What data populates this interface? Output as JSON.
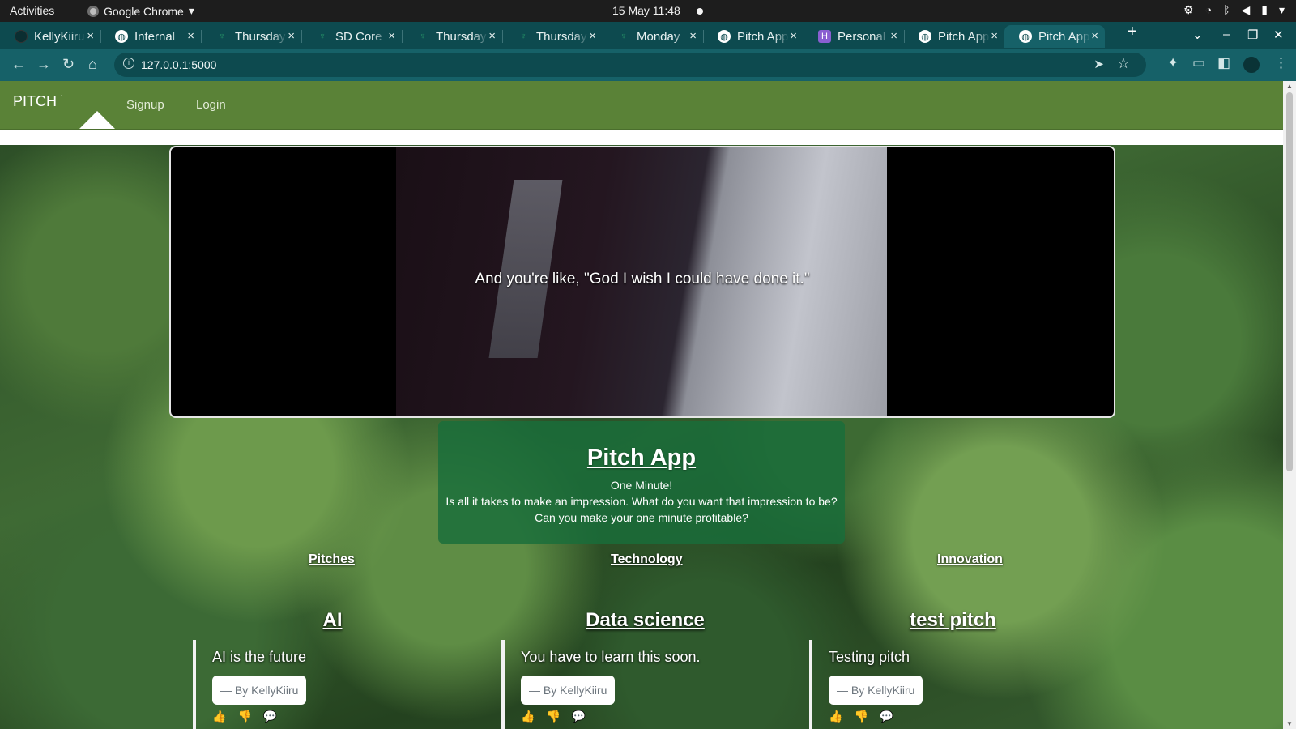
{
  "system_bar": {
    "activities": "Activities",
    "app_name": "Google Chrome",
    "app_menu_arrow": "▾",
    "datetime": "15 May  11:48"
  },
  "browser": {
    "tabs": [
      {
        "label": "KellyKiiru",
        "icon": "github-icon"
      },
      {
        "label": "Internal",
        "icon": "globe-icon"
      },
      {
        "label": "Thursday",
        "icon": "moringa-icon"
      },
      {
        "label": "SD Core",
        "icon": "moringa-icon"
      },
      {
        "label": "Thursday",
        "icon": "moringa-icon"
      },
      {
        "label": "Thursday",
        "icon": "moringa-icon"
      },
      {
        "label": "Monday",
        "icon": "moringa-icon"
      },
      {
        "label": "Pitch App",
        "icon": "globe-icon"
      },
      {
        "label": "Personal",
        "icon": "heroku-icon"
      },
      {
        "label": "Pitch App",
        "icon": "globe-icon"
      },
      {
        "label": "Pitch App",
        "icon": "globe-icon",
        "active": true
      }
    ],
    "url": "127.0.0.1:5000",
    "tab_close_glyph": "×",
    "new_tab_glyph": "+"
  },
  "site": {
    "brand": "PITCH",
    "nav_links": [
      "Signup",
      "Login"
    ],
    "video_caption": "And you're like, \"God I wish I could have done it.\"",
    "jumbotron": {
      "title": "Pitch App",
      "line1": "One Minute!",
      "line2": "Is all it takes to make an impression. What do you want that impression to be?",
      "line3": "Can you make your one minute profitable?"
    },
    "categories": [
      "Pitches",
      "Technology",
      "Innovation"
    ],
    "pitches": [
      {
        "title": "AI",
        "body": "AI is the future",
        "author": "— By KellyKiiru"
      },
      {
        "title": "Data science",
        "body": "You have to learn this soon.",
        "author": "— By KellyKiiru"
      },
      {
        "title": "test pitch",
        "body": "Testing pitch",
        "author": "— By KellyKiiru"
      }
    ]
  },
  "colors": {
    "site_nav": "#5a8237",
    "jumbotron": "#186e3a",
    "chrome_frame": "#0d4a4f",
    "chrome_toolbar": "#166168"
  }
}
